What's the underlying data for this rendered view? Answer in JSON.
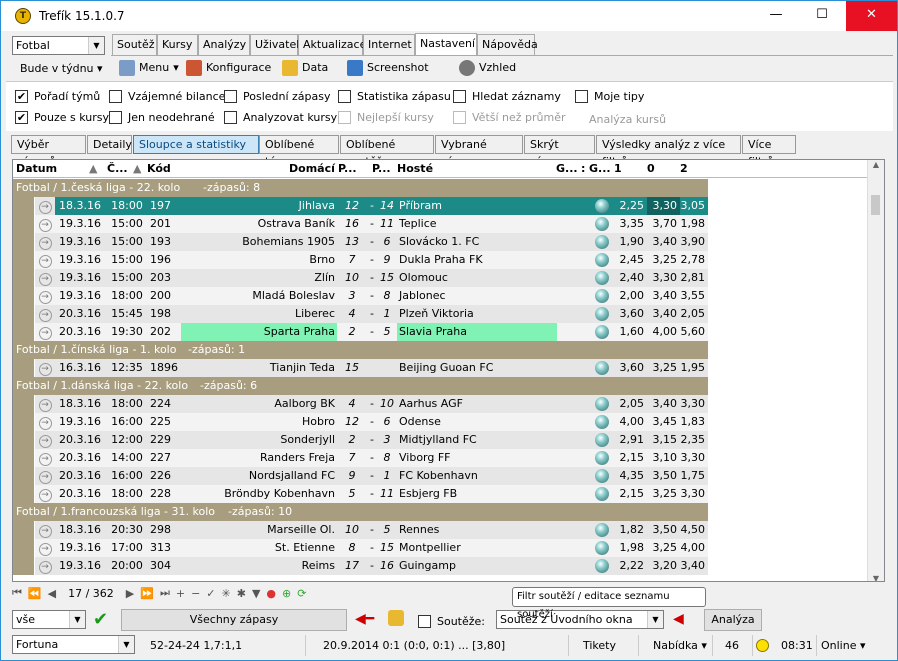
{
  "window": {
    "title": "Trefík 15.1.0.7",
    "min": "—",
    "max": "☐",
    "close": "✕"
  },
  "sport_select": "Fotbal",
  "menu_tabs": [
    "Soutěž",
    "Kursy",
    "Analýzy",
    "Uživatel",
    "Aktualizace",
    "Internet",
    "Nastavení",
    "Nápověda"
  ],
  "period_select": "Bude v týdnu",
  "toolbar": {
    "menu": "Menu",
    "config": "Konfigurace",
    "data": "Data",
    "screenshot": "Screenshot",
    "look": "Vzhled"
  },
  "checks": {
    "order": "Pořadí týmů",
    "mutual": "Vzájemné bilance",
    "last": "Poslední zápasy",
    "stats": "Statistika zápasu",
    "search": "Hledat záznamy",
    "mytips": "Moje tipy",
    "odds_only": "Pouze s kursy",
    "unplayed": "Jen neodehrané",
    "analyzed": "Analyzovat kursy",
    "best": "Nejlepší kursy",
    "bigger": "Větší než průměr",
    "odds_analysis": "Analýza kursů"
  },
  "sub_tabs": [
    "Výběr zápasů",
    "Detaily",
    "Sloupce a statistiky",
    "Oblíbené týmy",
    "Oblíbené soutěže",
    "Vybrané zápasy",
    "Skrýt zápasy",
    "Výsledky analýz z více filtrů",
    "Více filtrů"
  ],
  "columns": {
    "date": "Datum",
    "time": "Č...",
    "code": "Kód",
    "home": "Domácí",
    "p1": "P...",
    "p2": "P...",
    "away": "Hosté",
    "g1": "G...",
    "colon": ":",
    "g2": "G...",
    "o1": "1",
    "o0": "0",
    "o2": "2"
  },
  "groups": [
    {
      "name": "Fotbal / 1.česká liga - 22. kolo",
      "count": "-zápasů: 8",
      "rows": [
        {
          "d": "18.3.16",
          "t": "18:00",
          "k": "197",
          "h": "Jihlava",
          "s1": "12",
          "s2": "14",
          "a": "Příbram",
          "o1": "2,25",
          "o0": "3,30",
          "o2": "3,05",
          "sel": true
        },
        {
          "d": "19.3.16",
          "t": "15:00",
          "k": "201",
          "h": "Ostrava Baník",
          "s1": "16",
          "s2": "11",
          "a": "Teplice",
          "o1": "3,35",
          "o0": "3,70",
          "o2": "1,98"
        },
        {
          "d": "19.3.16",
          "t": "15:00",
          "k": "193",
          "h": "Bohemians 1905",
          "s1": "13",
          "s2": "6",
          "a": "Slovácko 1. FC",
          "o1": "1,90",
          "o0": "3,40",
          "o2": "3,90"
        },
        {
          "d": "19.3.16",
          "t": "15:00",
          "k": "196",
          "h": "Brno",
          "s1": "7",
          "s2": "9",
          "a": "Dukla Praha FK",
          "o1": "2,45",
          "o0": "3,25",
          "o2": "2,78"
        },
        {
          "d": "19.3.16",
          "t": "15:00",
          "k": "203",
          "h": "Zlín",
          "s1": "10",
          "s2": "15",
          "a": "Olomouc",
          "o1": "2,40",
          "o0": "3,30",
          "o2": "2,81"
        },
        {
          "d": "19.3.16",
          "t": "18:00",
          "k": "200",
          "h": "Mladá Boleslav",
          "s1": "3",
          "s2": "8",
          "a": "Jablonec",
          "o1": "2,00",
          "o0": "3,40",
          "o2": "3,55"
        },
        {
          "d": "20.3.16",
          "t": "15:45",
          "k": "198",
          "h": "Liberec",
          "s1": "4",
          "s2": "1",
          "a": "Plzeň Viktoria",
          "o1": "3,60",
          "o0": "3,40",
          "o2": "2,05"
        },
        {
          "d": "20.3.16",
          "t": "19:30",
          "k": "202",
          "h": "Sparta Praha",
          "s1": "2",
          "s2": "5",
          "a": "Slavia Praha",
          "o1": "1,60",
          "o0": "4,00",
          "o2": "5,60",
          "hl": true
        }
      ]
    },
    {
      "name": "Fotbal / 1.čínská liga - 1. kolo",
      "count": "-zápasů: 1",
      "rows": [
        {
          "d": "16.3.16",
          "t": "12:35",
          "k": "1896",
          "h": "Tianjin Teda",
          "s1": "15",
          "s2": "",
          "a": "Beijing Guoan FC",
          "o1": "3,60",
          "o0": "3,25",
          "o2": "1,95"
        }
      ]
    },
    {
      "name": "Fotbal / 1.dánská liga - 22. kolo",
      "count": "-zápasů: 6",
      "rows": [
        {
          "d": "18.3.16",
          "t": "18:00",
          "k": "224",
          "h": "Aalborg BK",
          "s1": "4",
          "s2": "10",
          "a": "Aarhus AGF",
          "o1": "2,05",
          "o0": "3,40",
          "o2": "3,30"
        },
        {
          "d": "19.3.16",
          "t": "16:00",
          "k": "225",
          "h": "Hobro",
          "s1": "12",
          "s2": "6",
          "a": "Odense",
          "o1": "4,00",
          "o0": "3,45",
          "o2": "1,83"
        },
        {
          "d": "20.3.16",
          "t": "12:00",
          "k": "229",
          "h": "Sonderjyll",
          "s1": "2",
          "s2": "3",
          "a": "Midtjylland FC",
          "o1": "2,91",
          "o0": "3,15",
          "o2": "2,35"
        },
        {
          "d": "20.3.16",
          "t": "14:00",
          "k": "227",
          "h": "Randers Freja",
          "s1": "7",
          "s2": "8",
          "a": "Viborg FF",
          "o1": "2,15",
          "o0": "3,10",
          "o2": "3,30"
        },
        {
          "d": "20.3.16",
          "t": "16:00",
          "k": "226",
          "h": "Nordsjalland FC",
          "s1": "9",
          "s2": "1",
          "a": "FC Kobenhavn",
          "o1": "4,35",
          "o0": "3,50",
          "o2": "1,75"
        },
        {
          "d": "20.3.16",
          "t": "18:00",
          "k": "228",
          "h": "Bröndby Kobenhavn",
          "s1": "5",
          "s2": "11",
          "a": "Esbjerg FB",
          "o1": "2,15",
          "o0": "3,25",
          "o2": "3,30"
        }
      ]
    },
    {
      "name": "Fotbal / 1.francouzská liga - 31. kolo",
      "count": "-zápasů: 10",
      "rows": [
        {
          "d": "18.3.16",
          "t": "20:30",
          "k": "298",
          "h": "Marseille Ol.",
          "s1": "10",
          "s2": "5",
          "a": "Rennes",
          "o1": "1,82",
          "o0": "3,50",
          "o2": "4,50"
        },
        {
          "d": "19.3.16",
          "t": "17:00",
          "k": "313",
          "h": "St. Etienne",
          "s1": "8",
          "s2": "15",
          "a": "Montpellier",
          "o1": "1,98",
          "o0": "3,25",
          "o2": "4,00"
        },
        {
          "d": "19.3.16",
          "t": "20:00",
          "k": "304",
          "h": "Reims",
          "s1": "17",
          "s2": "16",
          "a": "Guingamp",
          "o1": "2,22",
          "o0": "3,20",
          "o2": "3,40"
        }
      ]
    }
  ],
  "navigator": {
    "pos": "17 / 362"
  },
  "bottom": {
    "filter": "vše",
    "all_matches": "Všechny zápasy",
    "competitions_label": "Soutěže:",
    "competitions_select": "Soutěž z Úvodního okna",
    "analysis": "Analýza",
    "tooltip": "Filtr soutěží / editace seznamu soutěží"
  },
  "status": {
    "bookmaker": "Fortuna",
    "record": "52-24-24  1,7:1,1",
    "last": "20.9.2014 0:1 (0:0, 0:1) ... [3,80]",
    "tickets": "Tikety",
    "offer": "Nabídka",
    "count": "46",
    "time": "08:31",
    "online": "Online"
  }
}
